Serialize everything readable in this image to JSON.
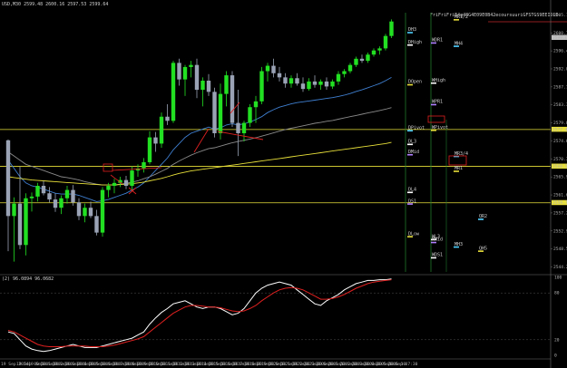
{
  "header": {
    "price_text": "USD,M30 2599.48 2600.16 2597.53 2599.64",
    "indicator_text": "(2) 96.0894 96.0682"
  },
  "top_right_text": "FriFriFriE4g48G4E09E0B42ecoursuuriGFSTGS9EEIDLD",
  "price_axis": {
    "ticks": [
      "2605.10",
      "2600.75",
      "2596.40",
      "2592.05",
      "2587.70",
      "2583.35",
      "2579.00",
      "2574.65",
      "2570.30",
      "2565.95",
      "2561.60",
      "2557.25",
      "2552.90",
      "2548.55",
      "2544.20"
    ],
    "highlighted": [
      "2599.6",
      "2577.4",
      "2568.5",
      "2559.7"
    ]
  },
  "indicator_axis": {
    "ticks": [
      "100",
      "80",
      "20",
      "0"
    ]
  },
  "time_axis": [
    "19 Sep 2024",
    "19 Sep 00:30",
    "19 Sep 01:30",
    "19 Sep 02:30",
    "19 Sep 03:30",
    "19 Sep 04:30",
    "19 Sep 05:30",
    "19 Sep 06:30",
    "19 Sep 07:30",
    "19 Sep 08:30",
    "19 Sep 09:30",
    "19 Sep 10:30",
    "19 Sep 11:30",
    "19 Sep 12:30",
    "19 Sep 13:30",
    "19 Sep 14:30",
    "19 Sep 15:30",
    "19 Sep 16:30",
    "19 Sep 17:30",
    "19 Sep 18:30",
    "19 Sep 19:30",
    "19 Sep 20:30",
    "19 Sep 21:30",
    "19 Sep 22:30",
    "19 Sep 23:30",
    "20 Sep 00:30",
    "20 Sep 01:30",
    "20 Sep 02:30",
    "20 Sep 03:30",
    "20 Sep 04:30",
    "20 Sep 05:30",
    "20 Sep 06:30",
    "20 Sep 07:30"
  ],
  "level_labels": [
    {
      "text": "DH3",
      "price": 2601.2,
      "color": "#e0e0e0"
    },
    {
      "text": "MR1/2",
      "price": 2604.3,
      "color": "#e0e0e0"
    },
    {
      "text": "DHigh",
      "price": 2598.2,
      "color": "#e0e0e0"
    },
    {
      "text": "WDR1",
      "price": 2598.7,
      "color": "#e0e0e0"
    },
    {
      "text": "MH4",
      "price": 2597.9,
      "color": "#e0e0e0"
    },
    {
      "text": "DOpen",
      "price": 2588.6,
      "color": "#e0e0e0"
    },
    {
      "text": "WHigh",
      "price": 2589.0,
      "color": "#e0e0e0"
    },
    {
      "text": "WPR1",
      "price": 2583.8,
      "color": "#e0e0e0"
    },
    {
      "text": "DPivot",
      "price": 2577.5,
      "color": "#e0e0e0"
    },
    {
      "text": "WPivot",
      "price": 2577.6,
      "color": "#e0e0e0"
    },
    {
      "text": "DL3",
      "price": 2574.2,
      "color": "#e0e0e0"
    },
    {
      "text": "DMid",
      "price": 2571.7,
      "color": "#e0e0e0"
    },
    {
      "text": "MR3/4",
      "price": 2571.3,
      "color": "#e0e0e0"
    },
    {
      "text": "MR1",
      "price": 2567.7,
      "color": "#e0e0e0"
    },
    {
      "text": "DL4",
      "price": 2562.6,
      "color": "#e0e0e0"
    },
    {
      "text": "DS1",
      "price": 2559.8,
      "color": "#e0e0e0"
    },
    {
      "text": "QR2",
      "price": 2556.1,
      "color": "#e0e0e0"
    },
    {
      "text": "DLow",
      "price": 2551.9,
      "color": "#e0e0e0"
    },
    {
      "text": "WL3",
      "price": 2551.2,
      "color": "#e0e0e0"
    },
    {
      "text": "WMid",
      "price": 2550.5,
      "color": "#e0e0e0"
    },
    {
      "text": "MH3",
      "price": 2549.4,
      "color": "#e0e0e0"
    },
    {
      "text": "QH5",
      "price": 2548.4,
      "color": "#e0e0e0"
    },
    {
      "text": "WDS1",
      "price": 2546.8,
      "color": "#e0e0e0"
    }
  ],
  "chart_data": {
    "type": "candlestick",
    "title": "",
    "xlabel": "",
    "ylabel": "",
    "ylim": [
      2543.0,
      2606.5
    ],
    "x_start": "19 Sep 2024",
    "interval": "M30",
    "candles": [
      [
        2574.8,
        2575.0,
        2548.0,
        2556.5
      ],
      [
        2556.5,
        2561.0,
        2545.5,
        2559.5
      ],
      [
        2559.5,
        2568.5,
        2548.5,
        2549.5
      ],
      [
        2549.5,
        2562.0,
        2547.0,
        2560.8
      ],
      [
        2560.8,
        2562.2,
        2557.6,
        2561.2
      ],
      [
        2561.2,
        2564.5,
        2560.0,
        2563.8
      ],
      [
        2563.8,
        2565.0,
        2561.5,
        2562.0
      ],
      [
        2562.0,
        2563.5,
        2559.8,
        2560.5
      ],
      [
        2560.5,
        2562.0,
        2557.5,
        2558.5
      ],
      [
        2558.5,
        2561.5,
        2557.0,
        2560.8
      ],
      [
        2560.8,
        2563.8,
        2559.5,
        2562.8
      ],
      [
        2562.8,
        2564.0,
        2559.0,
        2559.8
      ],
      [
        2559.8,
        2560.8,
        2555.5,
        2556.5
      ],
      [
        2556.5,
        2559.5,
        2555.0,
        2558.5
      ],
      [
        2558.5,
        2560.0,
        2556.0,
        2556.5
      ],
      [
        2556.5,
        2558.0,
        2551.8,
        2552.5
      ],
      [
        2552.5,
        2563.5,
        2551.5,
        2562.8
      ],
      [
        2562.8,
        2564.5,
        2561.0,
        2563.8
      ],
      [
        2563.8,
        2565.5,
        2562.0,
        2564.5
      ],
      [
        2564.5,
        2566.0,
        2563.5,
        2565.2
      ],
      [
        2565.2,
        2566.2,
        2563.0,
        2563.8
      ],
      [
        2563.8,
        2568.5,
        2562.5,
        2567.5
      ],
      [
        2567.5,
        2569.0,
        2566.0,
        2568.0
      ],
      [
        2568.0,
        2570.5,
        2567.0,
        2569.5
      ],
      [
        2569.5,
        2577.0,
        2569.0,
        2575.5
      ],
      [
        2575.5,
        2576.8,
        2572.0,
        2574.0
      ],
      [
        2574.0,
        2581.5,
        2573.0,
        2580.5
      ],
      [
        2580.5,
        2583.5,
        2578.5,
        2579.5
      ],
      [
        2579.5,
        2594.0,
        2579.0,
        2593.5
      ],
      [
        2593.5,
        2594.5,
        2588.0,
        2589.5
      ],
      [
        2589.5,
        2593.0,
        2585.5,
        2592.5
      ],
      [
        2592.5,
        2594.0,
        2590.0,
        2593.0
      ],
      [
        2593.0,
        2594.5,
        2585.0,
        2587.0
      ],
      [
        2587.0,
        2590.0,
        2583.0,
        2589.2
      ],
      [
        2589.2,
        2590.8,
        2585.5,
        2586.5
      ],
      [
        2586.5,
        2587.5,
        2575.5,
        2576.5
      ],
      [
        2576.5,
        2588.5,
        2575.0,
        2586.0
      ],
      [
        2586.0,
        2591.5,
        2583.0,
        2590.5
      ],
      [
        2590.5,
        2591.5,
        2578.0,
        2579.0
      ],
      [
        2579.0,
        2587.0,
        2571.0,
        2576.5
      ],
      [
        2576.5,
        2579.5,
        2574.5,
        2579.0
      ],
      [
        2579.0,
        2583.5,
        2578.0,
        2582.8
      ],
      [
        2582.8,
        2585.5,
        2579.0,
        2584.2
      ],
      [
        2584.2,
        2592.5,
        2583.5,
        2591.5
      ],
      [
        2591.5,
        2593.5,
        2589.0,
        2592.8
      ],
      [
        2592.8,
        2594.5,
        2590.0,
        2591.0
      ],
      [
        2591.0,
        2592.5,
        2589.0,
        2590.0
      ],
      [
        2590.0,
        2591.0,
        2587.5,
        2588.5
      ],
      [
        2588.5,
        2590.5,
        2587.5,
        2589.8
      ],
      [
        2589.8,
        2591.0,
        2588.0,
        2588.5
      ],
      [
        2588.5,
        2590.0,
        2586.5,
        2587.2
      ],
      [
        2587.2,
        2589.8,
        2586.8,
        2589.0
      ],
      [
        2589.0,
        2590.5,
        2587.5,
        2588.2
      ],
      [
        2588.2,
        2589.5,
        2587.0,
        2589.0
      ],
      [
        2589.0,
        2590.0,
        2587.0,
        2587.8
      ],
      [
        2587.8,
        2589.5,
        2587.2,
        2589.0
      ],
      [
        2589.0,
        2591.5,
        2588.2,
        2590.8
      ],
      [
        2590.8,
        2592.0,
        2590.0,
        2591.5
      ],
      [
        2591.5,
        2593.5,
        2591.0,
        2593.0
      ],
      [
        2593.0,
        2595.0,
        2592.5,
        2594.5
      ],
      [
        2594.5,
        2595.5,
        2593.5,
        2594.0
      ],
      [
        2594.0,
        2596.0,
        2593.5,
        2595.5
      ],
      [
        2595.5,
        2597.0,
        2595.0,
        2596.5
      ],
      [
        2596.5,
        2597.5,
        2595.5,
        2597.0
      ],
      [
        2597.0,
        2600.5,
        2596.5,
        2600.0
      ],
      [
        2600.0,
        2604.0,
        2599.5,
        2603.5
      ]
    ],
    "series": [
      {
        "name": "",
        "color": "#3f7fd0",
        "values": [
          2570.0,
          2568.0,
          2566.0,
          2564.5,
          2563.8,
          2563.5,
          2563.0,
          2562.5,
          2562.0,
          2561.8,
          2561.8,
          2561.8,
          2561.5,
          2561.0,
          2560.5,
          2560.0,
          2560.2,
          2560.5,
          2561.0,
          2561.5,
          2562.0,
          2562.8,
          2563.5,
          2564.5,
          2566.0,
          2567.5,
          2569.0,
          2570.5,
          2572.5,
          2574.0,
          2575.5,
          2576.5,
          2577.0,
          2577.5,
          2578.0,
          2577.5,
          2577.8,
          2578.5,
          2578.8,
          2578.5,
          2578.8,
          2579.2,
          2579.8,
          2580.5,
          2581.5,
          2582.2,
          2582.8,
          2583.2,
          2583.6,
          2583.9,
          2584.1,
          2584.3,
          2584.5,
          2584.7,
          2584.9,
          2585.1,
          2585.4,
          2585.7,
          2586.1,
          2586.6,
          2587.0,
          2587.5,
          2588.0,
          2588.5,
          2589.2,
          2590.0
        ]
      },
      {
        "name": "",
        "color": "#8a8a8a",
        "values": [
          2572.0,
          2571.0,
          2570.0,
          2569.0,
          2568.5,
          2568.0,
          2567.5,
          2567.0,
          2566.5,
          2566.0,
          2565.8,
          2565.5,
          2565.2,
          2564.8,
          2564.5,
          2564.2,
          2564.0,
          2564.0,
          2564.0,
          2564.2,
          2564.4,
          2564.7,
          2565.0,
          2565.5,
          2566.0,
          2566.6,
          2567.3,
          2568.0,
          2569.0,
          2569.8,
          2570.5,
          2571.2,
          2571.8,
          2572.3,
          2572.8,
          2573.0,
          2573.4,
          2573.8,
          2574.2,
          2574.5,
          2574.8,
          2575.1,
          2575.4,
          2575.8,
          2576.2,
          2576.6,
          2577.0,
          2577.4,
          2577.7,
          2578.0,
          2578.3,
          2578.6,
          2578.9,
          2579.1,
          2579.4,
          2579.6,
          2579.9,
          2580.2,
          2580.5,
          2580.8,
          2581.1,
          2581.4,
          2581.7,
          2582.0,
          2582.3,
          2582.7
        ]
      },
      {
        "name": "",
        "color": "#e8e03a",
        "values": [
          2566.0,
          2565.8,
          2565.6,
          2565.4,
          2565.2,
          2565.1,
          2565.0,
          2564.9,
          2564.8,
          2564.7,
          2564.6,
          2564.5,
          2564.4,
          2564.3,
          2564.2,
          2564.1,
          2564.0,
          2564.0,
          2564.0,
          2564.1,
          2564.2,
          2564.3,
          2564.5,
          2564.7,
          2565.0,
          2565.3,
          2565.6,
          2566.0,
          2566.4,
          2566.8,
          2567.1,
          2567.4,
          2567.6,
          2567.8,
          2568.0,
          2568.2,
          2568.4,
          2568.6,
          2568.8,
          2569.0,
          2569.2,
          2569.4,
          2569.6,
          2569.8,
          2570.0,
          2570.2,
          2570.4,
          2570.6,
          2570.8,
          2571.0,
          2571.2,
          2571.4,
          2571.6,
          2571.8,
          2572.0,
          2572.2,
          2572.4,
          2572.6,
          2572.8,
          2573.0,
          2573.2,
          2573.4,
          2573.6,
          2573.8,
          2574.0,
          2574.3
        ]
      }
    ],
    "horizontal_lines": [
      2577.4,
      2568.5,
      2559.7
    ],
    "indicator": {
      "ylim": [
        0,
        100
      ],
      "levels": [
        20,
        80
      ],
      "series": [
        {
          "name": "",
          "color": "#ffffff",
          "values": [
            30,
            28,
            20,
            12,
            8,
            6,
            5,
            6,
            8,
            10,
            12,
            14,
            12,
            10,
            10,
            10,
            12,
            14,
            16,
            18,
            20,
            22,
            26,
            30,
            40,
            48,
            55,
            60,
            66,
            68,
            70,
            66,
            62,
            60,
            62,
            62,
            60,
            56,
            52,
            54,
            60,
            70,
            80,
            86,
            90,
            92,
            94,
            92,
            90,
            84,
            78,
            72,
            66,
            64,
            70,
            74,
            78,
            84,
            88,
            92,
            94,
            96,
            96,
            97,
            97,
            98
          ]
        },
        {
          "name": "",
          "color": "#e02020",
          "values": [
            32,
            30,
            26,
            22,
            18,
            14,
            12,
            11,
            11,
            11,
            12,
            12,
            12,
            12,
            11,
            11,
            11,
            12,
            13,
            15,
            17,
            19,
            21,
            24,
            30,
            36,
            42,
            48,
            54,
            58,
            62,
            64,
            64,
            63,
            62,
            62,
            61,
            59,
            57,
            56,
            57,
            60,
            64,
            70,
            75,
            80,
            84,
            86,
            87,
            86,
            84,
            80,
            76,
            72,
            72,
            73,
            75,
            78,
            82,
            86,
            89,
            92,
            94,
            95,
            96,
            97
          ]
        }
      ]
    }
  }
}
